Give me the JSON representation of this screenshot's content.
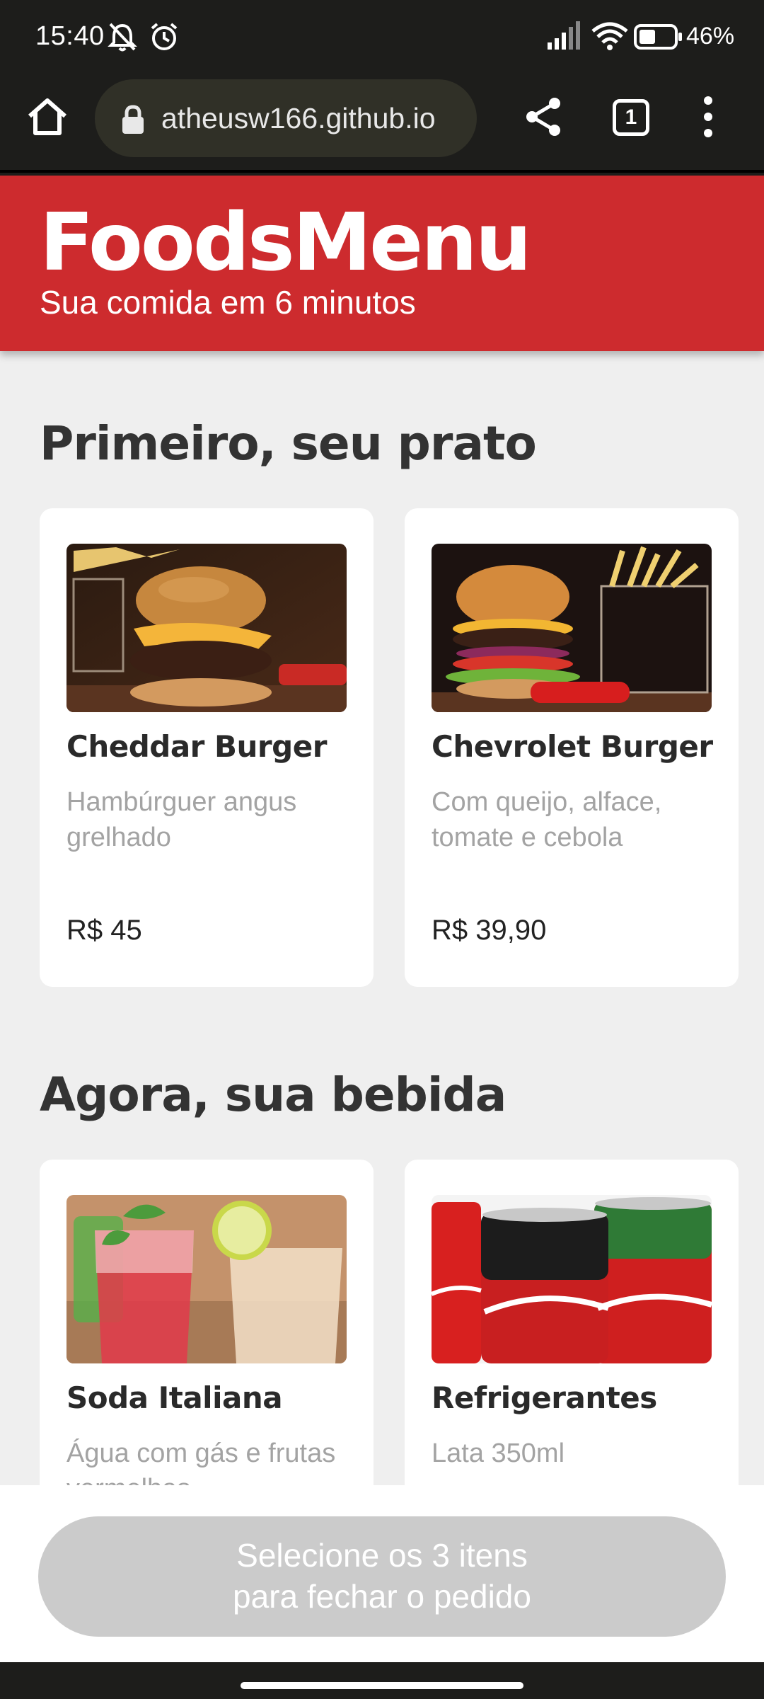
{
  "status_bar": {
    "time": "15:40",
    "battery": "46%",
    "icons": [
      "mute-icon",
      "alarm-icon",
      "signal-icon",
      "wifi-icon",
      "battery-icon"
    ]
  },
  "browser": {
    "url": "atheusw166.github.io",
    "tab_count": "1",
    "icons": [
      "home-icon",
      "lock-icon",
      "share-icon",
      "tabs-icon",
      "more-vert-icon"
    ]
  },
  "header": {
    "title": "FoodsMenu",
    "subtitle": "Sua comida em 6 minutos",
    "color": "#cd2b2e"
  },
  "sections": [
    {
      "title": "Primeiro, seu prato",
      "items": [
        {
          "name": "Cheddar Burger",
          "desc": "Hambúrguer angus grelhado",
          "price": "R$ 45"
        },
        {
          "name": "Chevrolet Burger",
          "desc": "Com queijo, alface, tomate e cebola",
          "price": "R$ 39,90"
        }
      ]
    },
    {
      "title": "Agora, sua bebida",
      "items": [
        {
          "name": "Soda Italiana",
          "desc": "Água com gás e frutas vermelhas",
          "price": ""
        },
        {
          "name": "Refrigerantes",
          "desc": "Lata 350ml",
          "price": ""
        }
      ]
    }
  ],
  "order_button": {
    "line1": "Selecione os 3 itens",
    "line2": "para fechar o pedido"
  }
}
